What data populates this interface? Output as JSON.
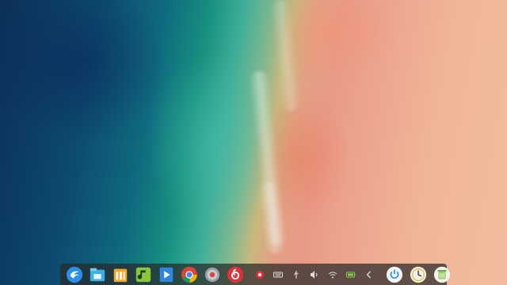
{
  "dock": {
    "apps": [
      {
        "name": "launcher-icon"
      },
      {
        "name": "file-manager-icon"
      },
      {
        "name": "app-store-icon"
      },
      {
        "name": "music-player-icon"
      },
      {
        "name": "video-player-icon"
      },
      {
        "name": "chrome-icon"
      },
      {
        "name": "settings-icon"
      },
      {
        "name": "netease-music-icon"
      }
    ],
    "tray": [
      {
        "name": "record-icon"
      },
      {
        "name": "keyboard-icon"
      },
      {
        "name": "usb-icon"
      },
      {
        "name": "volume-icon"
      },
      {
        "name": "wifi-icon"
      },
      {
        "name": "battery-icon"
      },
      {
        "name": "collapse-arrow-icon"
      }
    ],
    "system": [
      {
        "name": "power-icon"
      },
      {
        "name": "clock-icon"
      },
      {
        "name": "trash-icon"
      }
    ]
  },
  "colors": {
    "dock_bg": "#282828",
    "accent_blue": "#2b8fe8",
    "netease_red": "#e0303a",
    "battery_green": "#7ccf4a"
  }
}
